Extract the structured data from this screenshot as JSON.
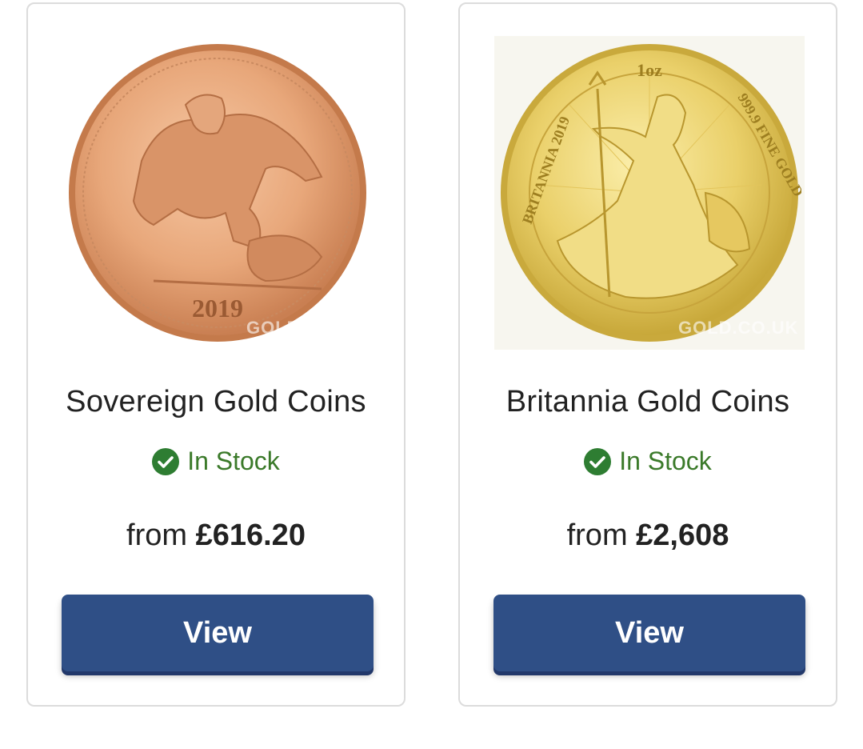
{
  "products": [
    {
      "name": "Sovereign Gold Coins",
      "stock_status": "In Stock",
      "price_prefix": "from",
      "price": "£616.20",
      "button_label": "View",
      "coin_year": "2019",
      "watermark": "GOLD.CO.UK",
      "coin_color": "#e7a87b"
    },
    {
      "name": "Britannia Gold Coins",
      "stock_status": "In Stock",
      "price_prefix": "from",
      "price": "£2,608",
      "button_label": "View",
      "coin_inscription_top": "1oz",
      "coin_inscription_left": "BRITANNIA 2019",
      "coin_inscription_right": "999.9 FINE GOLD",
      "watermark": "GOLD.CO.UK",
      "coin_color": "#e8cf6a"
    }
  ],
  "colors": {
    "button": "#2f4f86",
    "stock_green": "#3b7a2a"
  },
  "icons": {
    "stock": "check-circle-icon"
  }
}
